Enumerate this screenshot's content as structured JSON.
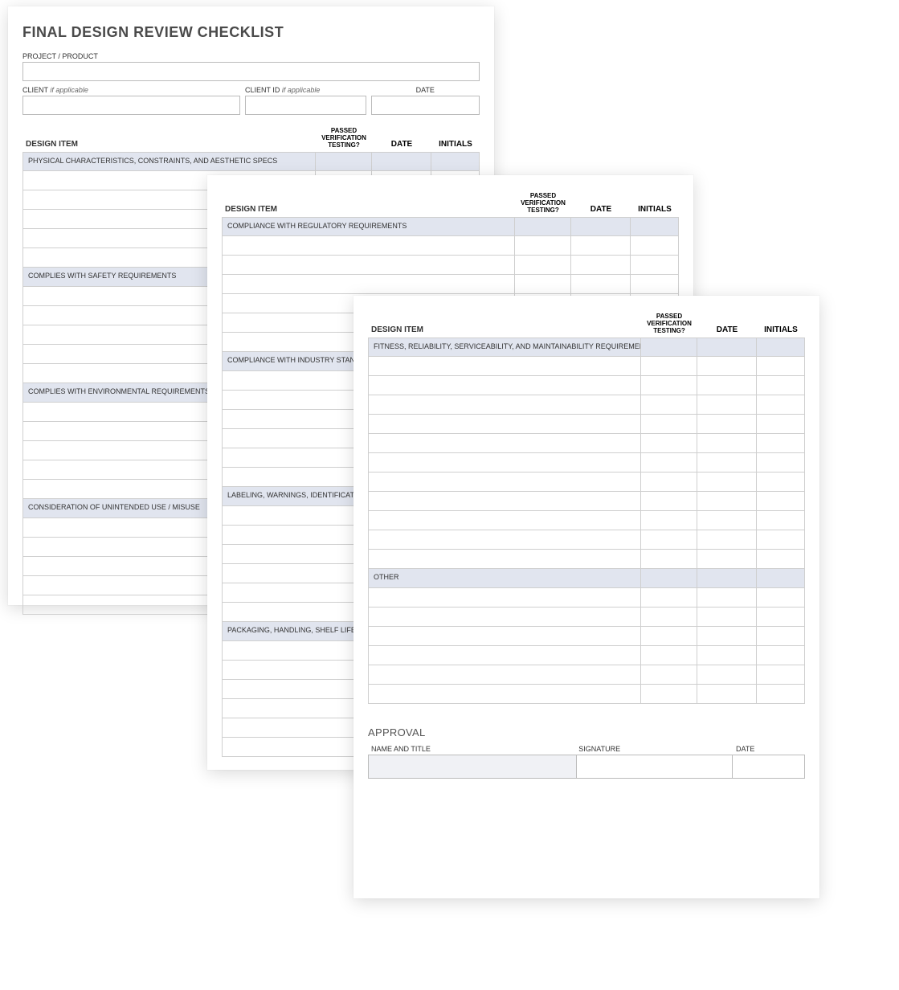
{
  "title": "FINAL DESIGN REVIEW CHECKLIST",
  "meta": {
    "project_label": "PROJECT / PRODUCT",
    "client_label": "CLIENT",
    "client_id_label": "CLIENT ID",
    "if_applicable": "if applicable",
    "date_label": "DATE"
  },
  "columns": {
    "item": "DESIGN ITEM",
    "passed": "PASSED VERIFICATION TESTING?",
    "date": "DATE",
    "initials": "INITIALS"
  },
  "approval": {
    "heading": "APPROVAL",
    "name_title": "NAME AND TITLE",
    "signature": "SIGNATURE",
    "date": "DATE"
  },
  "page1_sections": [
    "PHYSICAL CHARACTERISTICS, CONSTRAINTS, AND AESTHETIC SPECS",
    "COMPLIES WITH SAFETY REQUIREMENTS",
    "COMPLIES WITH ENVIRONMENTAL REQUIREMENTS",
    "CONSIDERATION OF UNINTENDED USE / MISUSE"
  ],
  "page2_sections": [
    "COMPLIANCE WITH REGULATORY REQUIREMENTS",
    "COMPLIANCE WITH INDUSTRY STANDARDS",
    "LABELING, WARNINGS, IDENTIFICATION, TRACEABILITY REQUIREMENTS",
    "PACKAGING, HANDLING, SHELF LIFE, STORAGE"
  ],
  "page3_sections": [
    "FITNESS, RELIABILITY, SERVICEABILITY, AND MAINTAINABILITY REQUIREMENTS",
    "OTHER"
  ],
  "page3_section_rows": [
    11,
    6
  ]
}
